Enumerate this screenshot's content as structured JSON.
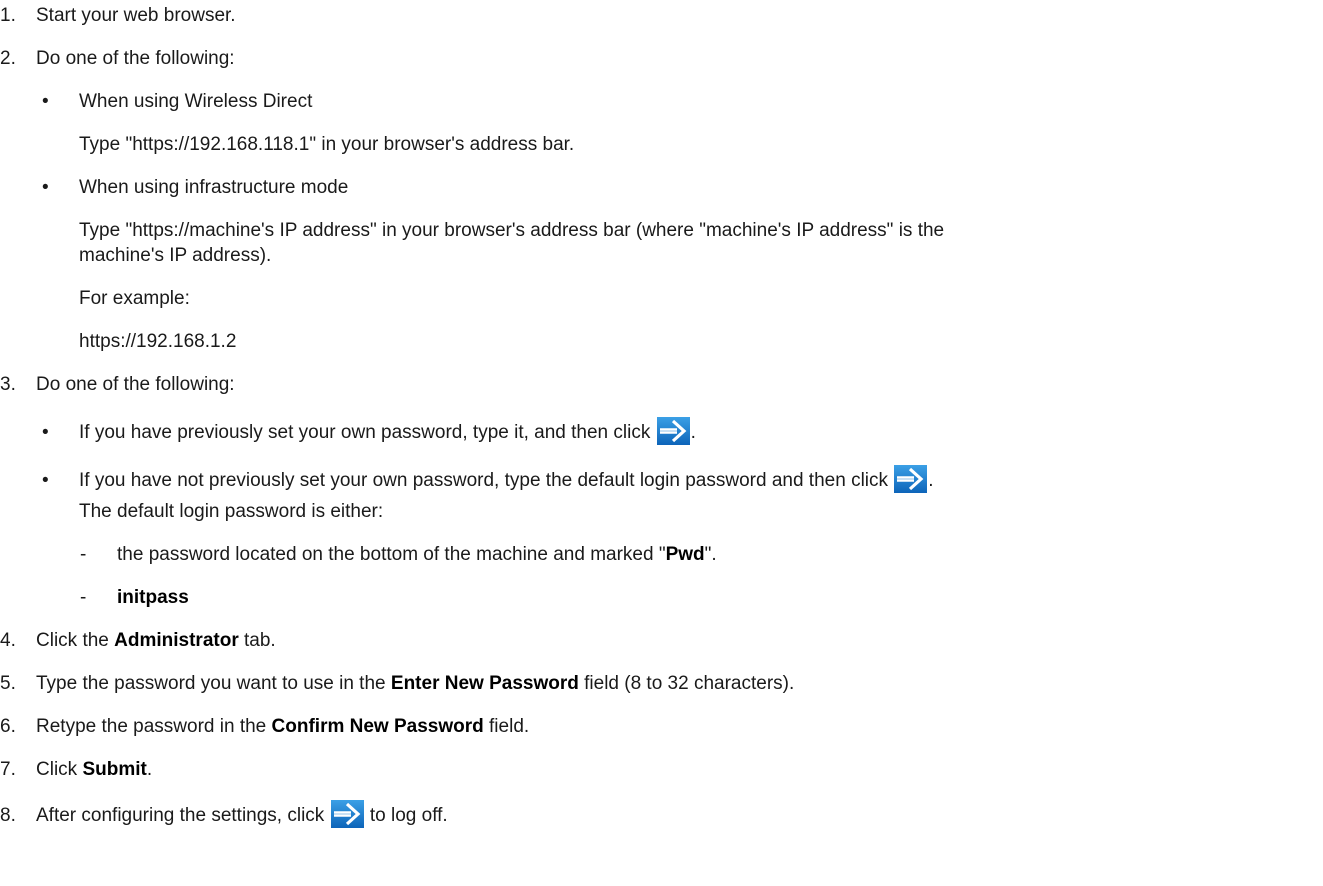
{
  "steps": {
    "s1": {
      "num": "1.",
      "text": "Start your web browser."
    },
    "s2": {
      "num": "2.",
      "text": "Do one of the following:",
      "b1": {
        "bullet": "•",
        "title": "When using Wireless Direct",
        "detail": "Type \"https://192.168.118.1\" in your browser's address bar."
      },
      "b2": {
        "bullet": "•",
        "title": "When using infrastructure mode",
        "detail_line1": "Type \"https://machine's IP address\" in your browser's address bar (where \"machine's IP address\" is the",
        "detail_line2": "machine's IP address).",
        "example_label": "For example:",
        "example_value": "https://192.168.1.2"
      }
    },
    "s3": {
      "num": "3.",
      "text": "Do one of the following:",
      "b1": {
        "bullet": "•",
        "text": "If you have previously set your own password, type it, and then click ",
        "after": "."
      },
      "b2": {
        "bullet": "•",
        "text": "If you have not previously set your own password, type the default login password and then click ",
        "after": ".",
        "note": "The default login password is either:",
        "d1": {
          "dash": "-",
          "pre": "the password located on the bottom of the machine and marked \"",
          "bold": "Pwd",
          "post": "\"."
        },
        "d2": {
          "dash": "-",
          "bold": "initpass"
        }
      }
    },
    "s4": {
      "num": "4.",
      "pre": "Click the ",
      "bold": "Administrator",
      "post": " tab."
    },
    "s5": {
      "num": "5.",
      "pre": "Type the password you want to use in the ",
      "bold": "Enter New Password",
      "post": " field (8 to 32 characters)."
    },
    "s6": {
      "num": "6.",
      "pre": "Retype the password in the ",
      "bold": "Confirm New Password",
      "post": " field."
    },
    "s7": {
      "num": "7.",
      "pre": "Click ",
      "bold": "Submit",
      "post": "."
    },
    "s8": {
      "num": "8.",
      "pre": "After configuring the settings, click ",
      "post": " to log off."
    }
  },
  "icons": {
    "arrow": "arrow-right-icon",
    "colors": {
      "bg_top": "#3ba0e6",
      "bg_bottom": "#0d64b9",
      "arrow": "#ffffff"
    }
  }
}
